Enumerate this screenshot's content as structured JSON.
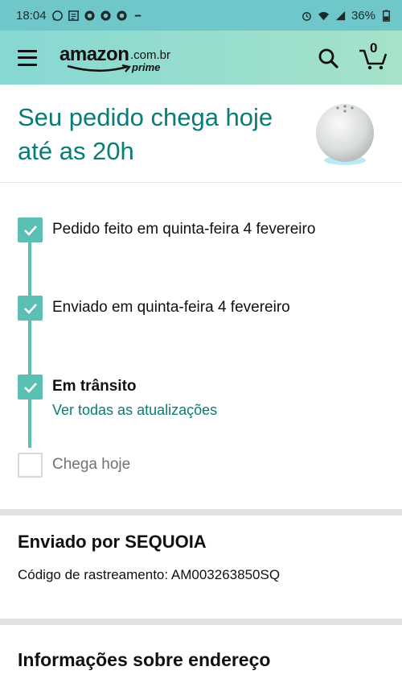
{
  "status_bar": {
    "time": "18:04",
    "battery": "36%",
    "icons": [
      "whatsapp-icon",
      "news-icon",
      "app-icon",
      "app-icon",
      "app-icon",
      "minus-icon",
      "alarm-icon",
      "wifi-icon",
      "signal-icon",
      "battery-icon"
    ]
  },
  "header": {
    "logo_text": "amazon",
    "logo_domain": ".com.br",
    "logo_sub": "prime",
    "cart_count": "0",
    "colors": {
      "gradient_start": "#86d8d3",
      "gradient_end": "#a6e2c9"
    }
  },
  "hero": {
    "title": "Seu pedido chega hoje até as 20h",
    "title_color": "#067d76",
    "product_image": "echo-dot-speaker"
  },
  "tracker": {
    "accent_color": "#5cbfb4",
    "steps": [
      {
        "label": "Pedido feito em quinta-feira 4 fevereiro",
        "done": true
      },
      {
        "label": "Enviado em quinta-feira 4 fevereiro",
        "done": true
      },
      {
        "label": "Em trânsito",
        "done": true,
        "link": "Ver todas as atualizações"
      },
      {
        "label": "Chega hoje",
        "done": false
      }
    ]
  },
  "shipment": {
    "shipped_by": "Enviado por SEQUOIA",
    "tracking": "Código de rastreamento: AM003263850SQ"
  },
  "address": {
    "title": "Informações sobre endereço"
  }
}
